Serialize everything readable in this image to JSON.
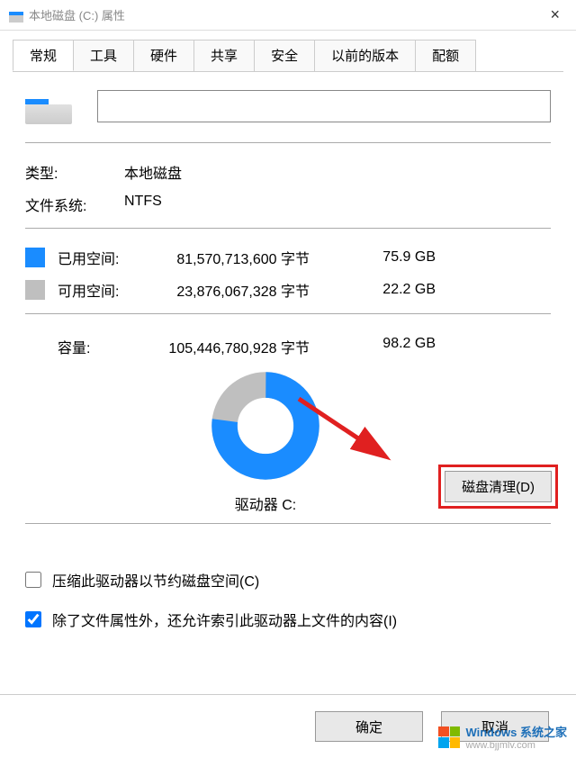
{
  "titlebar": {
    "title": "本地磁盘 (C:) 属性"
  },
  "tabs": {
    "general": "常规",
    "tools": "工具",
    "hardware": "硬件",
    "sharing": "共享",
    "security": "安全",
    "previous": "以前的版本",
    "quota": "配额"
  },
  "volume_label": "",
  "info": {
    "type_label": "类型:",
    "type_value": "本地磁盘",
    "fs_label": "文件系统:",
    "fs_value": "NTFS"
  },
  "space": {
    "used_label": "已用空间:",
    "used_bytes": "81,570,713,600 字节",
    "used_gb": "75.9 GB",
    "free_label": "可用空间:",
    "free_bytes": "23,876,067,328 字节",
    "free_gb": "22.2 GB",
    "cap_label": "容量:",
    "cap_bytes": "105,446,780,928 字节",
    "cap_gb": "98.2 GB"
  },
  "drive_name": "驱动器 C:",
  "cleanup_button": "磁盘清理(D)",
  "checks": {
    "compress": "压缩此驱动器以节约磁盘空间(C)",
    "index": "除了文件属性外，还允许索引此驱动器上文件的内容(I)"
  },
  "buttons": {
    "ok": "确定",
    "cancel": "取消"
  },
  "colors": {
    "used": "#1a8cff",
    "free": "#bfbfbf"
  },
  "chart_data": {
    "type": "pie",
    "title": "驱动器 C:",
    "series": [
      {
        "name": "已用空间",
        "value": 75.9,
        "unit": "GB",
        "color": "#1a8cff"
      },
      {
        "name": "可用空间",
        "value": 22.2,
        "unit": "GB",
        "color": "#bfbfbf"
      }
    ],
    "total": {
      "label": "容量",
      "value": 98.2,
      "unit": "GB"
    }
  },
  "watermark": {
    "text": "Windows 系统之家",
    "url": "www.bjjmlv.com"
  }
}
